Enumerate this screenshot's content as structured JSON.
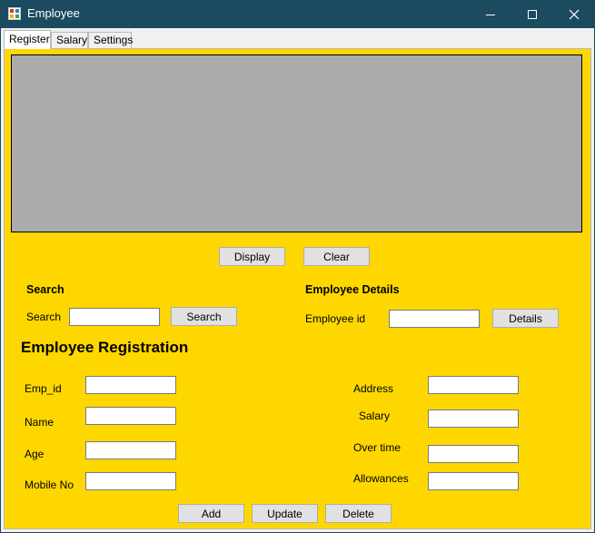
{
  "window": {
    "title": "Employee",
    "icon": "app-form-icon",
    "controls": [
      "minimize-icon",
      "maximize-icon",
      "close-icon"
    ]
  },
  "tabs": [
    {
      "label": "Register",
      "active": true
    },
    {
      "label": "Salary",
      "active": false
    },
    {
      "label": "Settings",
      "active": false
    }
  ],
  "grid_buttons": {
    "display": "Display",
    "clear": "Clear"
  },
  "search": {
    "heading": "Search",
    "label": "Search",
    "value": "",
    "button": "Search"
  },
  "details": {
    "heading": "Employee Details",
    "label": "Employee id",
    "value": "",
    "button": "Details"
  },
  "registration": {
    "heading": "Employee Registration",
    "left_fields": [
      {
        "label": "Emp_id",
        "value": ""
      },
      {
        "label": "Name",
        "value": ""
      },
      {
        "label": "Age",
        "value": ""
      },
      {
        "label": "Mobile No",
        "value": ""
      }
    ],
    "right_fields": [
      {
        "label": "Address",
        "value": ""
      },
      {
        "label": "Salary",
        "value": ""
      },
      {
        "label": "Over time",
        "value": ""
      },
      {
        "label": "Allowances",
        "value": ""
      }
    ],
    "buttons": {
      "add": "Add",
      "update": "Update",
      "delete": "Delete"
    }
  },
  "colors": {
    "panel": "#ffd700",
    "titlebar": "#1c4a5e",
    "grid": "#ababab",
    "button": "#e1e1e1"
  }
}
